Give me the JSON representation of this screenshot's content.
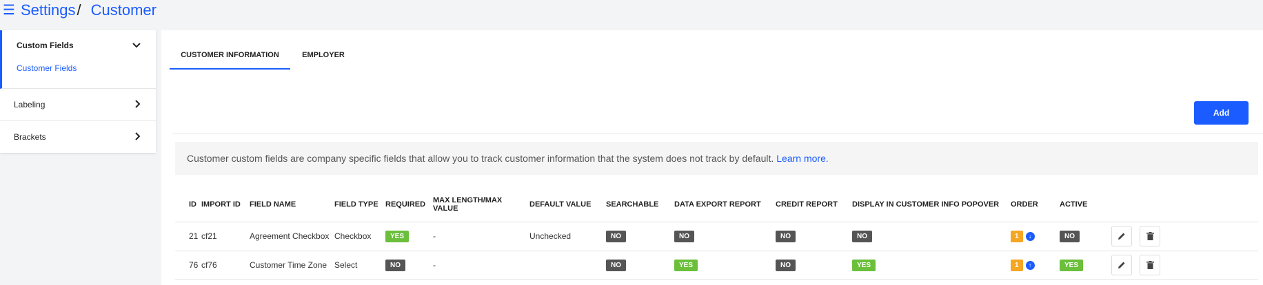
{
  "header": {
    "menu_icon": "hamburger-icon",
    "breadcrumb_root": "Settings",
    "breadcrumb_sep": "/",
    "breadcrumb_current": "Customer"
  },
  "sidebar": {
    "sections": [
      {
        "label": "Custom Fields",
        "icon": "chevron-down-icon",
        "chevron": "⌄",
        "open": true,
        "items": [
          {
            "label": "Customer Fields"
          }
        ]
      },
      {
        "label": "Labeling",
        "icon": "chevron-right-icon",
        "chevron": "›"
      },
      {
        "label": "Brackets",
        "icon": "chevron-right-icon",
        "chevron": "›"
      }
    ]
  },
  "tabs": [
    {
      "label": "CUSTOMER INFORMATION",
      "active": true
    },
    {
      "label": "EMPLOYER",
      "active": false
    }
  ],
  "actions": {
    "add_label": "Add"
  },
  "info": {
    "text": "Customer custom fields are company specific fields that allow you to track customer information that the system does not track by default.",
    "link": "Learn more."
  },
  "table": {
    "columns": [
      "ID",
      "IMPORT ID",
      "FIELD NAME",
      "FIELD TYPE",
      "REQUIRED",
      "MAX LENGTH/MAX VALUE",
      "DEFAULT VALUE",
      "SEARCHABLE",
      "DATA EXPORT REPORT",
      "CREDIT REPORT",
      "DISPLAY IN CUSTOMER INFO POPOVER",
      "ORDER",
      "ACTIVE",
      ""
    ],
    "rows": [
      {
        "id": "21",
        "import_id": "cf21",
        "field_name": "Agreement Checkbox",
        "field_type": "Checkbox",
        "required": "YES",
        "max": "-",
        "default": "Unchecked",
        "searchable": "NO",
        "export": "NO",
        "credit": "NO",
        "popover": "NO",
        "order": "1",
        "order_icon": "arrow-down-circle-icon",
        "order_arrow": "↓",
        "active": "NO"
      },
      {
        "id": "76",
        "import_id": "cf76",
        "field_name": "Customer Time Zone",
        "field_type": "Select",
        "required": "NO",
        "max": "-",
        "default": "",
        "searchable": "NO",
        "export": "YES",
        "credit": "NO",
        "popover": "YES",
        "order": "1",
        "order_icon": "arrow-up-circle-icon",
        "order_arrow": "↑",
        "active": "YES"
      }
    ]
  },
  "colors": {
    "accent": "#1a5cff",
    "yes": "#6bbf3b",
    "no": "#555555",
    "order": "#f5a623"
  }
}
